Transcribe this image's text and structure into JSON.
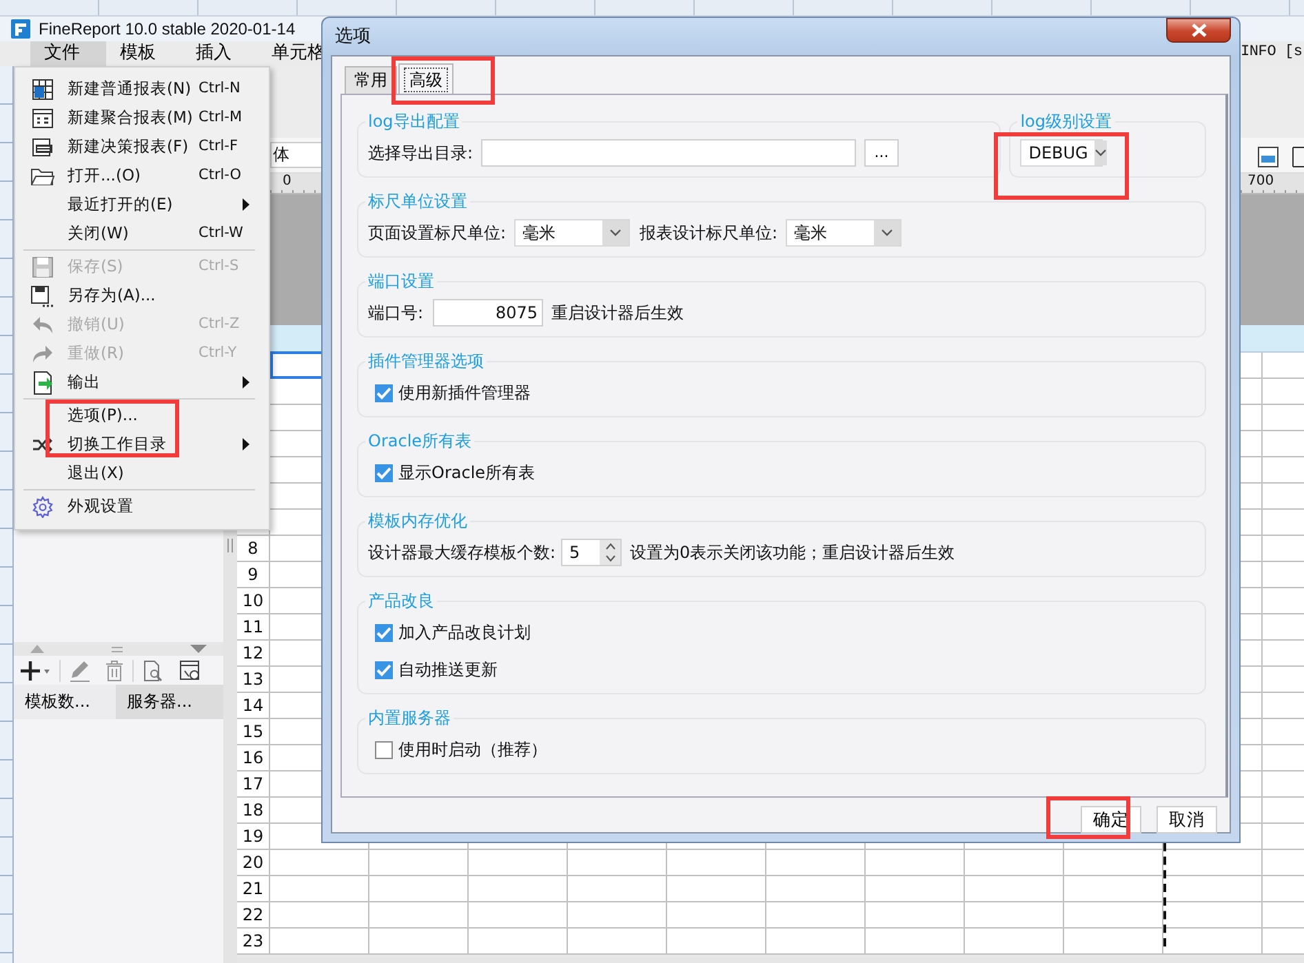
{
  "background_window": {
    "title": "FineReport 10.0 stable 2020-01-14",
    "menus": [
      {
        "label": "文件",
        "selected": true
      },
      {
        "label": "模板",
        "selected": false
      },
      {
        "label": "插入",
        "selected": false
      },
      {
        "label": "单元格",
        "selected": false
      }
    ],
    "log_text": "INFO [s",
    "font_field": {
      "value": "体"
    },
    "ruler_labels": [
      "0",
      "700"
    ],
    "row_numbers": [
      "8",
      "9",
      "10",
      "11",
      "12",
      "13",
      "14",
      "15",
      "16",
      "17",
      "18",
      "19",
      "20",
      "21",
      "22",
      "23"
    ],
    "sidebar_tabs": [
      {
        "label": "模板数...",
        "selected": false
      },
      {
        "label": "服务器...",
        "selected": true
      }
    ]
  },
  "file_menu": {
    "items": [
      {
        "kind": "item",
        "label": "新建普通报表(N)",
        "shortcut": "Ctrl-N",
        "disabled": false,
        "submenu": false,
        "highlighted": false
      },
      {
        "kind": "item",
        "label": "新建聚合报表(M)",
        "shortcut": "Ctrl-M",
        "disabled": false,
        "submenu": false,
        "highlighted": false
      },
      {
        "kind": "item",
        "label": "新建决策报表(F)",
        "shortcut": "Ctrl-F",
        "disabled": false,
        "submenu": false,
        "highlighted": false
      },
      {
        "kind": "item",
        "label": "打开...(O)",
        "shortcut": "Ctrl-O",
        "disabled": false,
        "submenu": false,
        "highlighted": false
      },
      {
        "kind": "item",
        "label": "最近打开的(E)",
        "disabled": false,
        "submenu": true,
        "highlighted": false
      },
      {
        "kind": "item",
        "label": "关闭(W)",
        "shortcut": "Ctrl-W",
        "disabled": false,
        "submenu": false,
        "highlighted": false
      },
      {
        "kind": "separator"
      },
      {
        "kind": "item",
        "label": "保存(S)",
        "shortcut": "Ctrl-S",
        "disabled": true,
        "submenu": false,
        "highlighted": false
      },
      {
        "kind": "item",
        "label": "另存为(A)...",
        "disabled": false,
        "submenu": false,
        "highlighted": false
      },
      {
        "kind": "item",
        "label": "撤销(U)",
        "shortcut": "Ctrl-Z",
        "disabled": true,
        "submenu": false,
        "highlighted": false
      },
      {
        "kind": "item",
        "label": "重做(R)",
        "shortcut": "Ctrl-Y",
        "disabled": true,
        "submenu": false,
        "highlighted": false
      },
      {
        "kind": "item",
        "label": "输出",
        "disabled": false,
        "submenu": true,
        "highlighted": false
      },
      {
        "kind": "separator"
      },
      {
        "kind": "item",
        "label": "选项(P)...",
        "disabled": false,
        "submenu": false,
        "highlighted": true
      },
      {
        "kind": "item",
        "label": "切换工作目录",
        "disabled": false,
        "submenu": true,
        "highlighted": false
      },
      {
        "kind": "item",
        "label": "退出(X)",
        "disabled": false,
        "submenu": false,
        "highlighted": false
      },
      {
        "kind": "separator"
      },
      {
        "kind": "item",
        "label": "外观设置",
        "disabled": false,
        "submenu": false,
        "highlighted": false
      }
    ]
  },
  "dialog": {
    "title": "选项",
    "tabs": [
      {
        "label": "常用",
        "selected": false,
        "highlighted": false
      },
      {
        "label": "高级",
        "selected": true,
        "highlighted": true
      }
    ],
    "log_level": {
      "title": "log级别设置",
      "value": "DEBUG",
      "highlighted": true
    },
    "sections": [
      {
        "kind": "directory",
        "title": "log导出配置",
        "label": "选择导出目录:",
        "browse": "..."
      },
      {
        "kind": "units",
        "title": "标尺单位设置",
        "fields": [
          {
            "label": "页面设置标尺单位:",
            "value": "毫米"
          },
          {
            "label": "报表设计标尺单位:",
            "value": "毫米"
          }
        ]
      },
      {
        "kind": "port",
        "title": "端口设置",
        "label": "端口号:",
        "value": "8075",
        "note": "重启设计器后生效"
      },
      {
        "kind": "checks",
        "title": "插件管理器选项",
        "options": [
          {
            "label": "使用新插件管理器",
            "checked": true
          }
        ]
      },
      {
        "kind": "checks",
        "title": "Oracle所有表",
        "options": [
          {
            "label": "显示Oracle所有表",
            "checked": true
          }
        ]
      },
      {
        "kind": "cache",
        "title": "模板内存优化",
        "label": "设计器最大缓存模板个数:",
        "value": "5",
        "note": "设置为0表示关闭该功能；重启设计器后生效"
      },
      {
        "kind": "checks",
        "title": "产品改良",
        "options": [
          {
            "label": "加入产品改良计划",
            "checked": true
          },
          {
            "label": "自动推送更新",
            "checked": true
          }
        ]
      },
      {
        "kind": "checks",
        "title": "内置服务器",
        "options": [
          {
            "label": "使用时启动（推荐）",
            "checked": false
          }
        ]
      }
    ],
    "buttons": [
      {
        "label": "确定",
        "highlighted": true
      },
      {
        "label": "取消",
        "highlighted": false
      }
    ]
  }
}
